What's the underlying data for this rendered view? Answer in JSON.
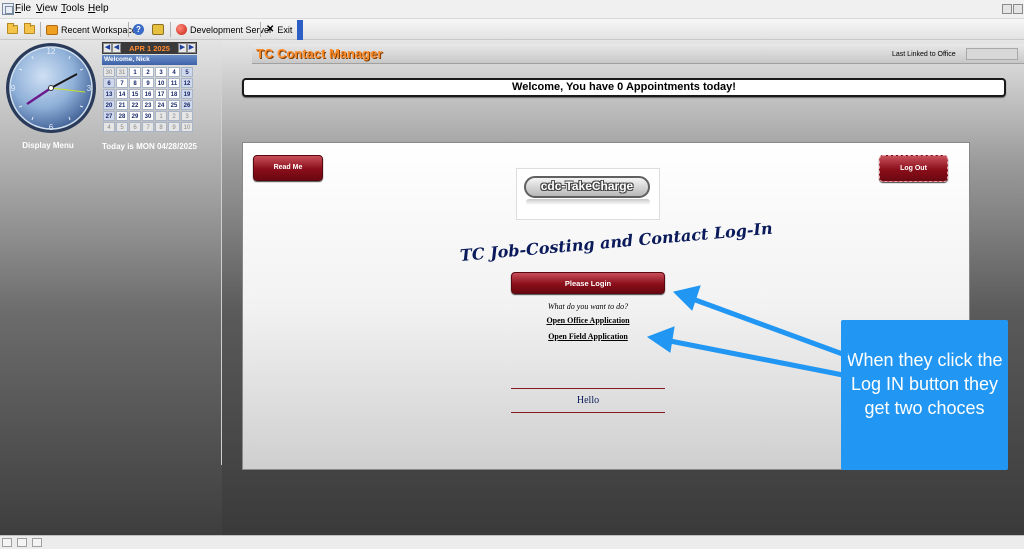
{
  "menu": {
    "file": "File",
    "view": "View",
    "tools": "Tools",
    "help": "Help"
  },
  "toolbar": {
    "recent_workspaces": "Recent Workspaces",
    "development_server": "Development Server",
    "exit": "Exit"
  },
  "clock": {
    "label": "Display Menu",
    "numbers": [
      "12",
      "3",
      "6",
      "9"
    ],
    "time": "10:10"
  },
  "calendar": {
    "month": "APR 1 2025",
    "welcome": "Welcome, Nick",
    "days": [
      {
        "d": "30",
        "dim": true
      },
      {
        "d": "31",
        "dim": true
      },
      {
        "d": "1"
      },
      {
        "d": "2"
      },
      {
        "d": "3"
      },
      {
        "d": "4"
      },
      {
        "d": "5",
        "cur": true
      },
      {
        "d": "6",
        "cur": true
      },
      {
        "d": "7"
      },
      {
        "d": "8"
      },
      {
        "d": "9"
      },
      {
        "d": "10"
      },
      {
        "d": "11"
      },
      {
        "d": "12",
        "cur": true
      },
      {
        "d": "13",
        "cur": true
      },
      {
        "d": "14"
      },
      {
        "d": "15"
      },
      {
        "d": "16"
      },
      {
        "d": "17"
      },
      {
        "d": "18"
      },
      {
        "d": "19",
        "cur": true
      },
      {
        "d": "20",
        "cur": true
      },
      {
        "d": "21"
      },
      {
        "d": "22"
      },
      {
        "d": "23"
      },
      {
        "d": "24"
      },
      {
        "d": "25"
      },
      {
        "d": "26",
        "cur": true
      },
      {
        "d": "27",
        "cur": true
      },
      {
        "d": "28"
      },
      {
        "d": "29"
      },
      {
        "d": "30"
      },
      {
        "d": "1",
        "dim": true
      },
      {
        "d": "2",
        "dim": true
      },
      {
        "d": "3",
        "dim": true
      },
      {
        "d": "4",
        "dim": true
      },
      {
        "d": "5",
        "dim": true
      },
      {
        "d": "6",
        "dim": true
      },
      {
        "d": "7",
        "dim": true
      },
      {
        "d": "8",
        "dim": true
      },
      {
        "d": "9",
        "dim": true
      },
      {
        "d": "10",
        "dim": true
      }
    ],
    "today": "Today is MON 04/28/2025"
  },
  "header": {
    "title": "TC Contact Manager",
    "last_linked": "Last Linked to Office"
  },
  "welcome": "Welcome, You have 0 Appointments today!",
  "login": {
    "read_me": "Read Me",
    "log_out": "Log Out",
    "logo": "cdc-TakeCharge",
    "heading": "TC Job-Costing and Contact Log-In",
    "please_login": "Please Login",
    "question": "What do you want to do?",
    "office_app": "Open Office Application",
    "field_app": "Open Field Application",
    "hello": "Hello"
  },
  "callout": {
    "text": "When they click the Log IN button they get two choces"
  },
  "colors": {
    "accent_orange": "#ff8c28",
    "button_red": "#8a0e1a",
    "callout_blue": "#2196f3"
  }
}
